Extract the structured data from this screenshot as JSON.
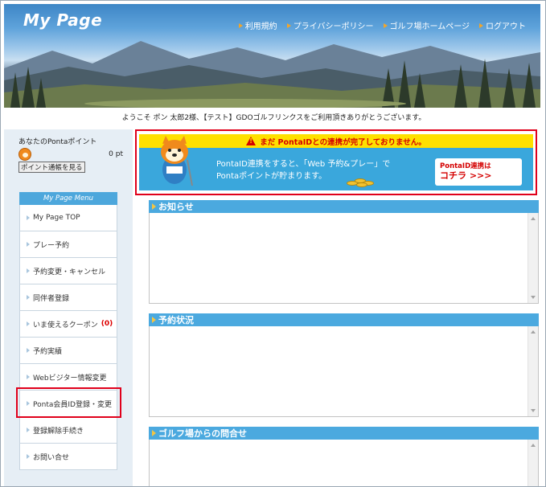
{
  "header": {
    "title": "My Page",
    "nav": [
      "利用規約",
      "プライバシーポリシー",
      "ゴルフ場ホームページ",
      "ログアウト"
    ]
  },
  "welcome": "ようこそ ポン 太郎2様、【テスト】GDOゴルフリンクスをご利用頂きありがとうございます。",
  "ponta": {
    "title": "あなたのPontaポイント",
    "points": "0 pt",
    "button": "ポイント通帳を見る"
  },
  "menu": {
    "heading": "My Page Menu",
    "items": [
      {
        "label": "My Page TOP"
      },
      {
        "label": "プレー予約"
      },
      {
        "label": "予約変更・キャンセル"
      },
      {
        "label": "同伴者登録"
      },
      {
        "label": "いま使えるクーポン",
        "badge": "(0)"
      },
      {
        "label": "予約実績"
      },
      {
        "label": "Webビジター情報変更"
      },
      {
        "label": "Ponta会員ID登録・変更"
      },
      {
        "label": "登録解除手続き"
      },
      {
        "label": "お問い合せ"
      }
    ]
  },
  "banner": {
    "warning": "まだ PontaIDとの連携が完了しておりません。",
    "line1": "PontaID連携をすると、「Web 予約&プレー」で",
    "line2": "Pontaポイントが貯まります。",
    "cta_line1": "PontaID連携は",
    "cta_line2": "コチラ >>>"
  },
  "panels": [
    {
      "title": "お知らせ"
    },
    {
      "title": "予約状況"
    },
    {
      "title": "ゴルフ場からの問合せ"
    }
  ],
  "colors": {
    "accent": "#4ba9df",
    "highlight": "#e0001b",
    "warning_bg": "#ffe000"
  }
}
